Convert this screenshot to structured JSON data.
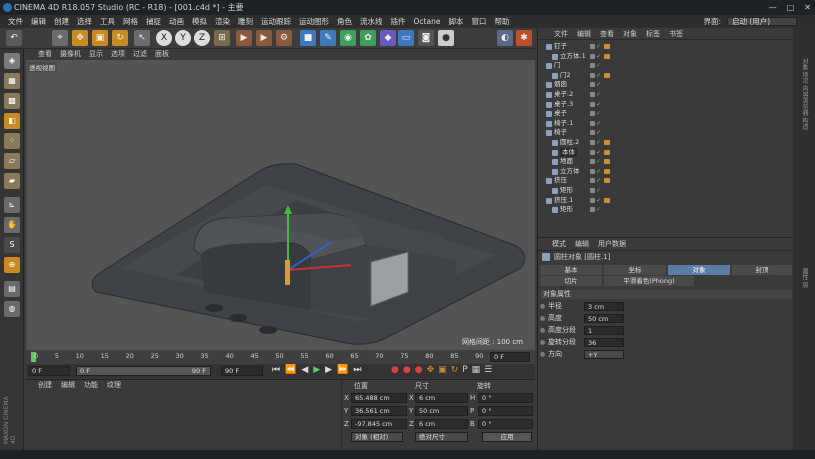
{
  "window": {
    "title": "CINEMA 4D R18.057 Studio (RC - R18) - [001.c4d *] - 主要",
    "controls": [
      "—",
      "□",
      "✕"
    ]
  },
  "menu": [
    "文件",
    "编辑",
    "创建",
    "选择",
    "工具",
    "网格",
    "捕捉",
    "动画",
    "模拟",
    "渲染",
    "雕刻",
    "运动跟踪",
    "运动图形",
    "角色",
    "流水线",
    "插件",
    "Octane",
    "脚本",
    "窗口",
    "帮助"
  ],
  "layout": {
    "label": "界面:",
    "value": "启动 (用户)"
  },
  "toolbar": {
    "undo_icon": "↶",
    "tools": [
      "select-live",
      "move",
      "scale",
      "rotate",
      "recent"
    ],
    "axis_x": "X",
    "axis_y": "Y",
    "axis_z": "Z",
    "coord_system": "world"
  },
  "viewport": {
    "menu": [
      "查看",
      "摄像机",
      "显示",
      "选项",
      "过滤",
      "面板"
    ],
    "label": "透视视图",
    "grid_spacing": "网格间距 : 100 cm"
  },
  "timeline": {
    "ticks": [
      "0",
      "5",
      "10",
      "15",
      "20",
      "25",
      "30",
      "35",
      "40",
      "45",
      "50",
      "55",
      "60",
      "65",
      "70",
      "75",
      "80",
      "85",
      "90"
    ],
    "end_field": "0 F"
  },
  "transport": {
    "start": "0 F",
    "preview_start": "0 F",
    "preview_end": "90 F",
    "end": "90 F"
  },
  "material_manager": {
    "menu": [
      "创建",
      "编辑",
      "功能",
      "纹理"
    ]
  },
  "coordinates": {
    "headers": {
      "position": "位置",
      "size": "尺寸",
      "rotation": "旋转"
    },
    "rows": [
      {
        "axis": "X",
        "pos": "65.488 cm",
        "size": "6 cm",
        "rot_axis": "H",
        "rot": "0 °"
      },
      {
        "axis": "Y",
        "pos": "36.561 cm",
        "size": "50 cm",
        "rot_axis": "P",
        "rot": "0 °"
      },
      {
        "axis": "Z",
        "pos": "-97.845 cm",
        "size": "6 cm",
        "rot_axis": "B",
        "rot": "0 °"
      }
    ],
    "mode_object": "对象 (相对)",
    "mode_size": "绝对尺寸",
    "apply_label": "应用"
  },
  "object_manager": {
    "menu": [
      "文件",
      "编辑",
      "查看",
      "对象",
      "标签",
      "书签"
    ],
    "items": [
      {
        "name": "钉子",
        "indent": 0,
        "tag": true
      },
      {
        "name": "立方体.1",
        "indent": 1,
        "tag": true
      },
      {
        "name": "门",
        "indent": 0,
        "tag": false
      },
      {
        "name": "门2",
        "indent": 1,
        "tag": true
      },
      {
        "name": "烟囱",
        "indent": 0,
        "tag": false
      },
      {
        "name": "桌子.2",
        "indent": 0,
        "tag": false
      },
      {
        "name": "桌子.3",
        "indent": 0,
        "tag": false
      },
      {
        "name": "桌子",
        "indent": 0,
        "tag": false
      },
      {
        "name": "椅子.1",
        "indent": 0,
        "tag": false
      },
      {
        "name": "椅子",
        "indent": 0,
        "tag": false
      },
      {
        "name": "圆柱.2",
        "indent": 1,
        "tag": true
      },
      {
        "name": "本体",
        "indent": 1,
        "tag": true,
        "editing": true
      },
      {
        "name": "地面",
        "indent": 1,
        "tag": true
      },
      {
        "name": "立方体",
        "indent": 1,
        "tag": true
      },
      {
        "name": "挤压",
        "indent": 0,
        "tag": true
      },
      {
        "name": "矩形",
        "indent": 1,
        "tag": false
      },
      {
        "name": "挤压.1",
        "indent": 0,
        "tag": true
      },
      {
        "name": "矩形",
        "indent": 1,
        "tag": false
      }
    ]
  },
  "attributes": {
    "menu": [
      "模式",
      "编辑",
      "用户数据"
    ],
    "object_title": "圆柱对象 [圆柱.1]",
    "tabs_row1": [
      "基本",
      "坐标",
      "对象",
      "封顶"
    ],
    "tabs_row2": [
      "切片",
      "平滑着色(Phong)"
    ],
    "active_tab": "对象",
    "section": "对象属性",
    "props": [
      {
        "label": "半径",
        "value": "3 cm"
      },
      {
        "label": "高度",
        "value": "50 cm"
      },
      {
        "label": "高度分段",
        "value": "1"
      },
      {
        "label": "旋转分段",
        "value": "36"
      },
      {
        "label": "方向",
        "value": "+Y"
      }
    ]
  },
  "right_sidebar": [
    "对象",
    "场次",
    "内容浏览器",
    "构造",
    "属性",
    "层"
  ],
  "brand": "MAXON CINEMA 4D",
  "colors": {
    "accent": "#5a7ca8",
    "tag": "#d18d2a",
    "check": "#6cc46c"
  }
}
